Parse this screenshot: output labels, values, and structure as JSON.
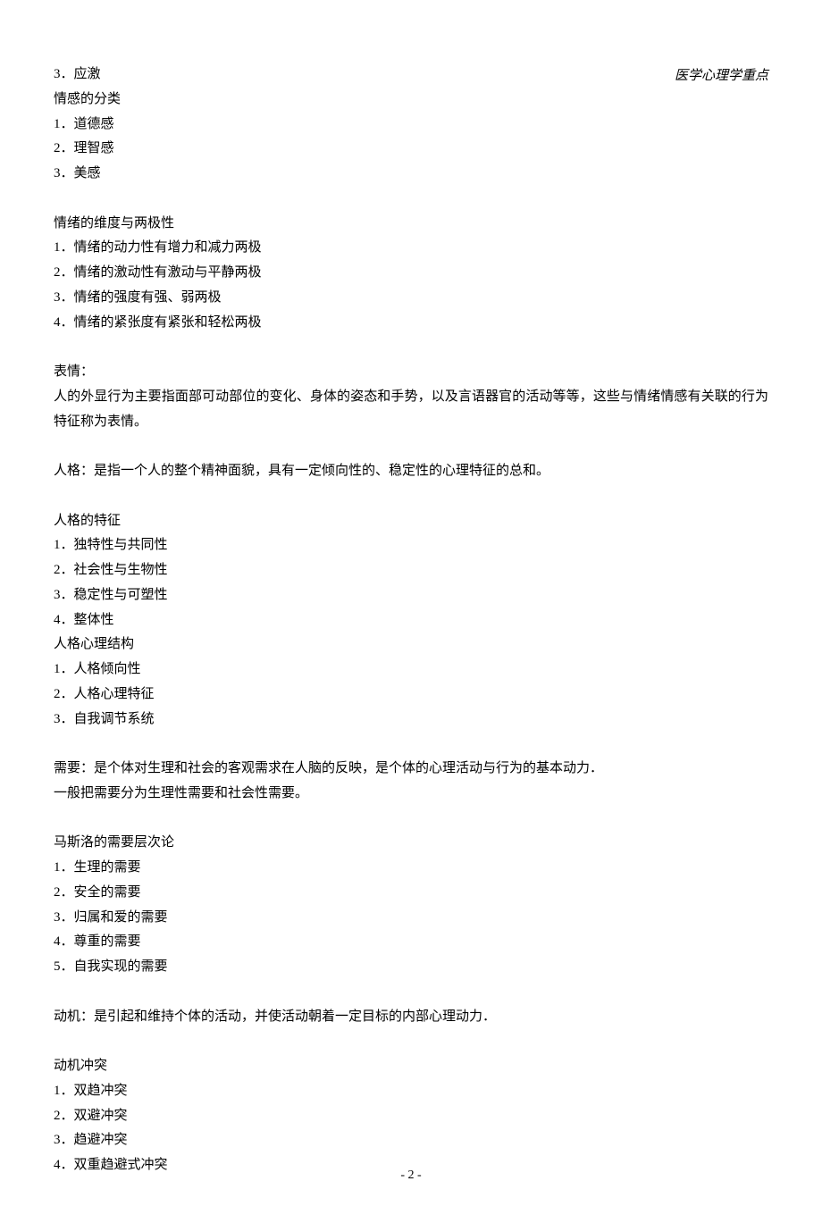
{
  "header": "医学心理学重点",
  "body": {
    "line1": "3．应激",
    "emotion_classification": {
      "title": "情感的分类",
      "item1": "1．道德感",
      "item2": "2．理智感",
      "item3": "3．美感"
    },
    "dimensions": {
      "title": "情绪的维度与两极性",
      "item1": "1．情绪的动力性有增力和减力两极",
      "item2": "2．情绪的激动性有激动与平静两极",
      "item3": "3．情绪的强度有强、弱两极",
      "item4": "4．情绪的紧张度有紧张和轻松两极"
    },
    "expression": {
      "title": "表情：",
      "text": "人的外显行为主要指面部可动部位的变化、身体的姿态和手势，以及言语器官的活动等等，这些与情绪情感有关联的行为特征称为表情。"
    },
    "personality_def": "人格：是指一个人的整个精神面貌，具有一定倾向性的、稳定性的心理特征的总和。",
    "personality_features": {
      "title": "人格的特征",
      "item1": "1．独特性与共同性",
      "item2": "2．社会性与生物性",
      "item3": "3．稳定性与可塑性",
      "item4": "4．整体性"
    },
    "personality_structure": {
      "title": "人格心理结构",
      "item1": "1．人格倾向性",
      "item2": "2．人格心理特征",
      "item3": "3．自我调节系统"
    },
    "need": {
      "line1": "需要：是个体对生理和社会的客观需求在人脑的反映，是个体的心理活动与行为的基本动力．",
      "line2": "一般把需要分为生理性需要和社会性需要。"
    },
    "maslow": {
      "title": "马斯洛的需要层次论",
      "item1": "1．生理的需要",
      "item2": "2．安全的需要",
      "item3": "3．归属和爱的需要",
      "item4": "4．尊重的需要",
      "item5": "5．自我实现的需要"
    },
    "motivation_def": "动机：是引起和维持个体的活动，并使活动朝着一定目标的内部心理动力．",
    "conflict": {
      "title": "动机冲突",
      "item1": "1．双趋冲突",
      "item2": "2．双避冲突",
      "item3": "3．趋避冲突",
      "item4": "4．双重趋避式冲突"
    }
  },
  "page_number": "- 2 -"
}
